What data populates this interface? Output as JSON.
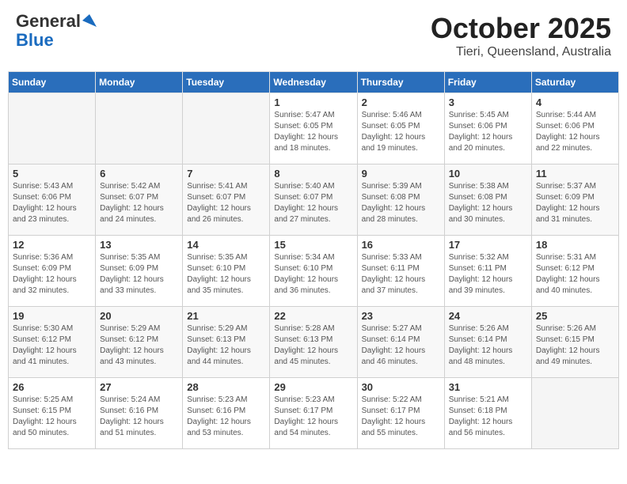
{
  "header": {
    "logo_general": "General",
    "logo_blue": "Blue",
    "month_title": "October 2025",
    "location": "Tieri, Queensland, Australia"
  },
  "calendar": {
    "days_of_week": [
      "Sunday",
      "Monday",
      "Tuesday",
      "Wednesday",
      "Thursday",
      "Friday",
      "Saturday"
    ],
    "weeks": [
      [
        {
          "day": "",
          "info": ""
        },
        {
          "day": "",
          "info": ""
        },
        {
          "day": "",
          "info": ""
        },
        {
          "day": "1",
          "info": "Sunrise: 5:47 AM\nSunset: 6:05 PM\nDaylight: 12 hours\nand 18 minutes."
        },
        {
          "day": "2",
          "info": "Sunrise: 5:46 AM\nSunset: 6:05 PM\nDaylight: 12 hours\nand 19 minutes."
        },
        {
          "day": "3",
          "info": "Sunrise: 5:45 AM\nSunset: 6:06 PM\nDaylight: 12 hours\nand 20 minutes."
        },
        {
          "day": "4",
          "info": "Sunrise: 5:44 AM\nSunset: 6:06 PM\nDaylight: 12 hours\nand 22 minutes."
        }
      ],
      [
        {
          "day": "5",
          "info": "Sunrise: 5:43 AM\nSunset: 6:06 PM\nDaylight: 12 hours\nand 23 minutes."
        },
        {
          "day": "6",
          "info": "Sunrise: 5:42 AM\nSunset: 6:07 PM\nDaylight: 12 hours\nand 24 minutes."
        },
        {
          "day": "7",
          "info": "Sunrise: 5:41 AM\nSunset: 6:07 PM\nDaylight: 12 hours\nand 26 minutes."
        },
        {
          "day": "8",
          "info": "Sunrise: 5:40 AM\nSunset: 6:07 PM\nDaylight: 12 hours\nand 27 minutes."
        },
        {
          "day": "9",
          "info": "Sunrise: 5:39 AM\nSunset: 6:08 PM\nDaylight: 12 hours\nand 28 minutes."
        },
        {
          "day": "10",
          "info": "Sunrise: 5:38 AM\nSunset: 6:08 PM\nDaylight: 12 hours\nand 30 minutes."
        },
        {
          "day": "11",
          "info": "Sunrise: 5:37 AM\nSunset: 6:09 PM\nDaylight: 12 hours\nand 31 minutes."
        }
      ],
      [
        {
          "day": "12",
          "info": "Sunrise: 5:36 AM\nSunset: 6:09 PM\nDaylight: 12 hours\nand 32 minutes."
        },
        {
          "day": "13",
          "info": "Sunrise: 5:35 AM\nSunset: 6:09 PM\nDaylight: 12 hours\nand 33 minutes."
        },
        {
          "day": "14",
          "info": "Sunrise: 5:35 AM\nSunset: 6:10 PM\nDaylight: 12 hours\nand 35 minutes."
        },
        {
          "day": "15",
          "info": "Sunrise: 5:34 AM\nSunset: 6:10 PM\nDaylight: 12 hours\nand 36 minutes."
        },
        {
          "day": "16",
          "info": "Sunrise: 5:33 AM\nSunset: 6:11 PM\nDaylight: 12 hours\nand 37 minutes."
        },
        {
          "day": "17",
          "info": "Sunrise: 5:32 AM\nSunset: 6:11 PM\nDaylight: 12 hours\nand 39 minutes."
        },
        {
          "day": "18",
          "info": "Sunrise: 5:31 AM\nSunset: 6:12 PM\nDaylight: 12 hours\nand 40 minutes."
        }
      ],
      [
        {
          "day": "19",
          "info": "Sunrise: 5:30 AM\nSunset: 6:12 PM\nDaylight: 12 hours\nand 41 minutes."
        },
        {
          "day": "20",
          "info": "Sunrise: 5:29 AM\nSunset: 6:12 PM\nDaylight: 12 hours\nand 43 minutes."
        },
        {
          "day": "21",
          "info": "Sunrise: 5:29 AM\nSunset: 6:13 PM\nDaylight: 12 hours\nand 44 minutes."
        },
        {
          "day": "22",
          "info": "Sunrise: 5:28 AM\nSunset: 6:13 PM\nDaylight: 12 hours\nand 45 minutes."
        },
        {
          "day": "23",
          "info": "Sunrise: 5:27 AM\nSunset: 6:14 PM\nDaylight: 12 hours\nand 46 minutes."
        },
        {
          "day": "24",
          "info": "Sunrise: 5:26 AM\nSunset: 6:14 PM\nDaylight: 12 hours\nand 48 minutes."
        },
        {
          "day": "25",
          "info": "Sunrise: 5:26 AM\nSunset: 6:15 PM\nDaylight: 12 hours\nand 49 minutes."
        }
      ],
      [
        {
          "day": "26",
          "info": "Sunrise: 5:25 AM\nSunset: 6:15 PM\nDaylight: 12 hours\nand 50 minutes."
        },
        {
          "day": "27",
          "info": "Sunrise: 5:24 AM\nSunset: 6:16 PM\nDaylight: 12 hours\nand 51 minutes."
        },
        {
          "day": "28",
          "info": "Sunrise: 5:23 AM\nSunset: 6:16 PM\nDaylight: 12 hours\nand 53 minutes."
        },
        {
          "day": "29",
          "info": "Sunrise: 5:23 AM\nSunset: 6:17 PM\nDaylight: 12 hours\nand 54 minutes."
        },
        {
          "day": "30",
          "info": "Sunrise: 5:22 AM\nSunset: 6:17 PM\nDaylight: 12 hours\nand 55 minutes."
        },
        {
          "day": "31",
          "info": "Sunrise: 5:21 AM\nSunset: 6:18 PM\nDaylight: 12 hours\nand 56 minutes."
        },
        {
          "day": "",
          "info": ""
        }
      ]
    ]
  }
}
